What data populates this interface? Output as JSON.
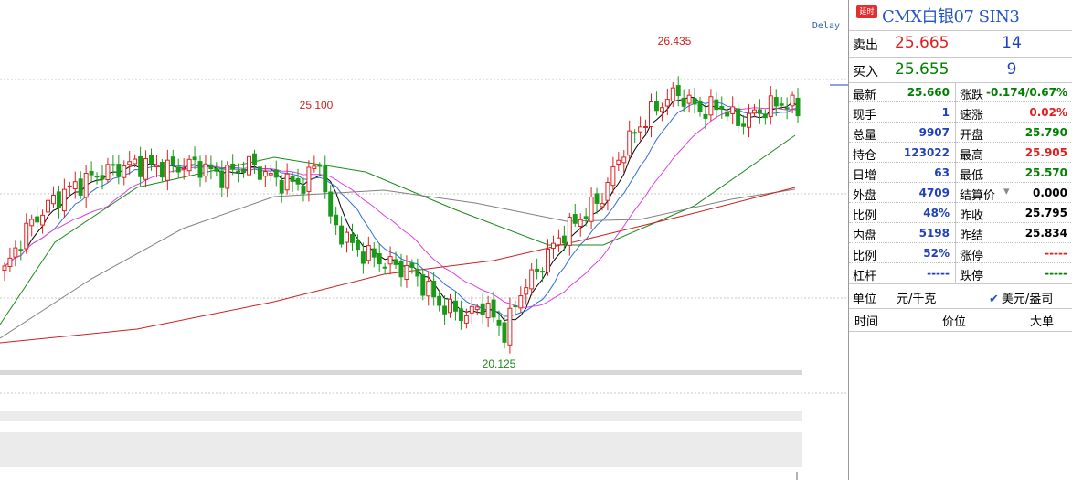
{
  "chart_data": {
    "type": "candlestick",
    "annotations": {
      "high_1": "25.100",
      "high_2": "26.435",
      "low_1": "20.125"
    },
    "delay_label": "Delay",
    "colors": {
      "up": "#e02020",
      "down": "#1a9a1a",
      "ma5": "#000000",
      "ma10": "#2f6fd6",
      "ma20": "#e040e0",
      "ma60": "#1a8a1a",
      "ma120": "#808080",
      "ma250": "#cc2020"
    }
  },
  "quote": {
    "badge": "延时",
    "title": "CMX白银07 SIN3",
    "sell": {
      "label": "卖出",
      "price": "25.665",
      "volume": "14"
    },
    "buy": {
      "label": "买入",
      "price": "25.655",
      "volume": "9"
    },
    "stats_left": [
      {
        "label": "最新",
        "value": "25.660",
        "color": "#008000"
      },
      {
        "label": "现手",
        "value": "1",
        "color": "#2040c0"
      },
      {
        "label": "总量",
        "value": "9907",
        "color": "#2040c0"
      },
      {
        "label": "持仓",
        "value": "123022",
        "color": "#2040c0"
      },
      {
        "label": "日增",
        "value": "63",
        "color": "#2040c0"
      },
      {
        "label": "外盘",
        "value": "4709",
        "color": "#2040c0"
      },
      {
        "label": "比例",
        "value": "48%",
        "color": "#2040c0"
      },
      {
        "label": "内盘",
        "value": "5198",
        "color": "#2040c0"
      },
      {
        "label": "比例",
        "value": "52%",
        "color": "#2040c0"
      },
      {
        "label": "杠杆",
        "value": "-----",
        "color": "#2040c0"
      }
    ],
    "stats_right": [
      {
        "label": "涨跌",
        "value": "-0.174/0.67%",
        "color": "#008000"
      },
      {
        "label": "速涨",
        "value": "0.02%",
        "color": "#e02020"
      },
      {
        "label": "开盘",
        "value": "25.790",
        "color": "#008000"
      },
      {
        "label": "最高",
        "value": "25.905",
        "color": "#e02020"
      },
      {
        "label": "最低",
        "value": "25.570",
        "color": "#008000"
      },
      {
        "label": "结算价",
        "value": "0.000",
        "color": "#000000"
      },
      {
        "label": "昨收",
        "value": "25.795",
        "color": "#000000"
      },
      {
        "label": "昨结",
        "value": "25.834",
        "color": "#000000"
      },
      {
        "label": "涨停",
        "value": "-----",
        "color": "#e02020"
      },
      {
        "label": "跌停",
        "value": "-----",
        "color": "#008000"
      }
    ],
    "unit": {
      "label": "单位",
      "value": "元/千克",
      "option": "美元/盎司"
    },
    "ticks_header": {
      "time": "时间",
      "price": "价位",
      "lot": "大单"
    }
  }
}
